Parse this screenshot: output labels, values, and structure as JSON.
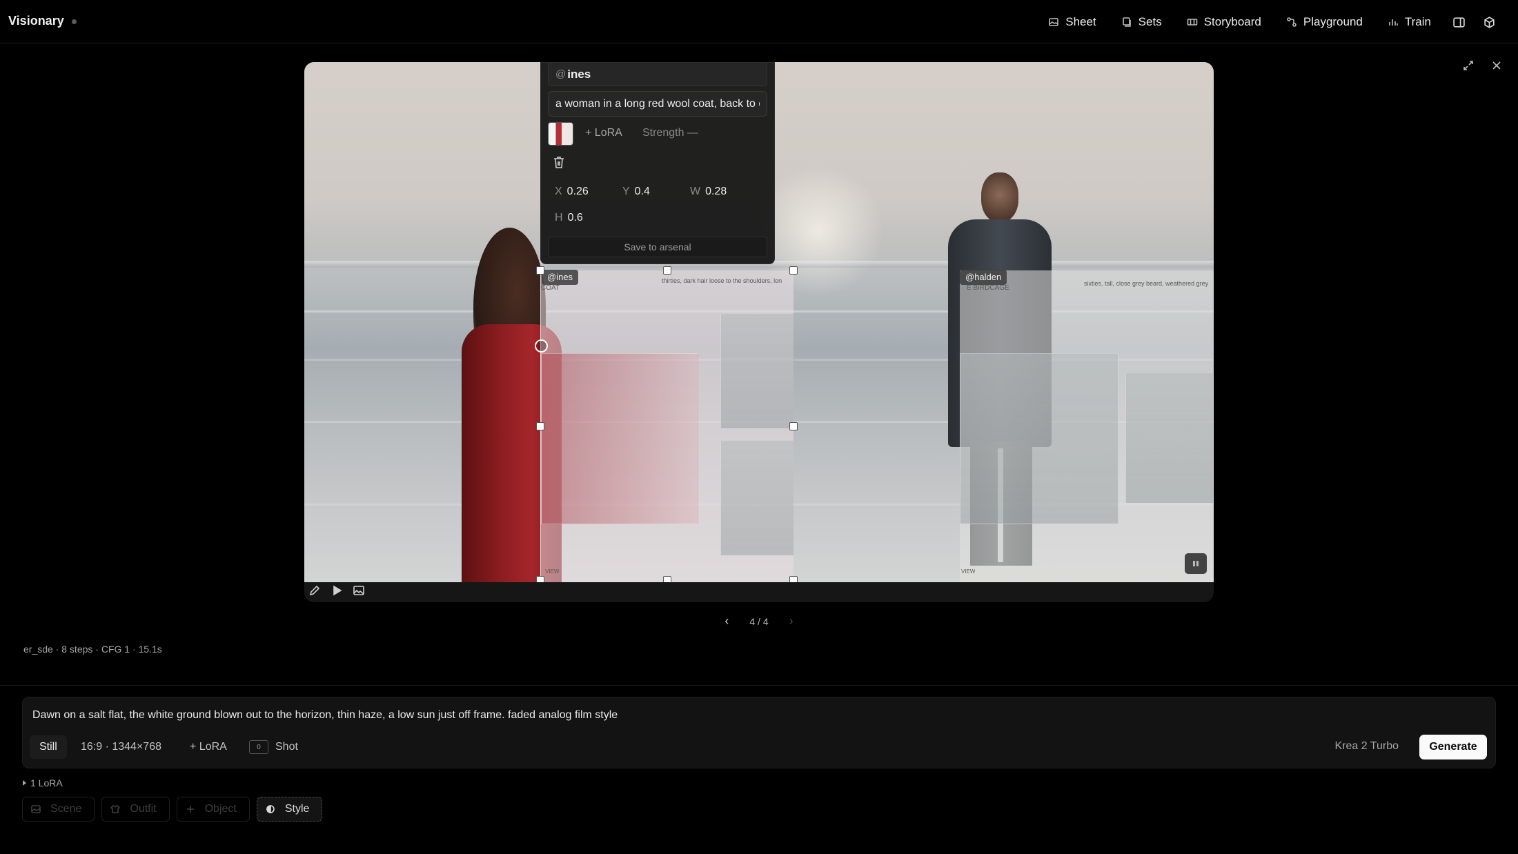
{
  "app": {
    "title": "Visionary"
  },
  "nav": {
    "items": [
      {
        "label": "Sheet",
        "icon": "image-icon"
      },
      {
        "label": "Sets",
        "icon": "stack-icon"
      },
      {
        "label": "Storyboard",
        "icon": "film-icon"
      },
      {
        "label": "Playground",
        "icon": "nodes-icon"
      },
      {
        "label": "Train",
        "icon": "bar-chart-icon"
      }
    ],
    "panel_icon": "sidebar-icon",
    "cube_icon": "cube-icon"
  },
  "canvas": {
    "regions": [
      {
        "tag": "@ines",
        "ref_title": "COAT",
        "ref_desc": "thirties, dark hair loose to the shoulders, lon",
        "ref_footer": "VIEW"
      },
      {
        "tag": "@halden",
        "ref_title": "E BIRDCAGE",
        "ref_desc": "sixties, tall, close grey beard, weathered grey",
        "ref_footer": "VIEW"
      }
    ]
  },
  "popover": {
    "at_symbol": "@",
    "name": "ines",
    "prompt": "a woman in a long red wool coat, back to camera",
    "lora_label": "+ LoRA",
    "strength_label": "Strength —",
    "x_label": "X",
    "x": "0.26",
    "y_label": "Y",
    "y": "0.4",
    "w_label": "W",
    "w": "0.28",
    "h_label": "H",
    "h": "0.6",
    "save_label": "Save to arsenal"
  },
  "pager": {
    "text": "4 / 4",
    "prev": "‹",
    "next": "›"
  },
  "meta": {
    "text": "er_sde · 8 steps · CFG 1 · 15.1s"
  },
  "composer": {
    "prompt": "Dawn on a salt flat, the white ground blown out to the horizon, thin haze, a low sun just off frame. faded analog film style",
    "mode": "Still",
    "aspect": "16:9 · 1344×768",
    "lora": "+ LoRA",
    "shot_icon": "0",
    "shot": "Shot",
    "model": "Krea 2 Turbo",
    "generate": "Generate"
  },
  "lora_summary": "1 LoRA",
  "tags": [
    {
      "label": "Scene",
      "icon": "image-icon"
    },
    {
      "label": "Outfit",
      "icon": "shirt-icon"
    },
    {
      "label": "Object",
      "icon": "plus-icon"
    },
    {
      "label": "Style",
      "icon": "half-circle-icon"
    }
  ]
}
